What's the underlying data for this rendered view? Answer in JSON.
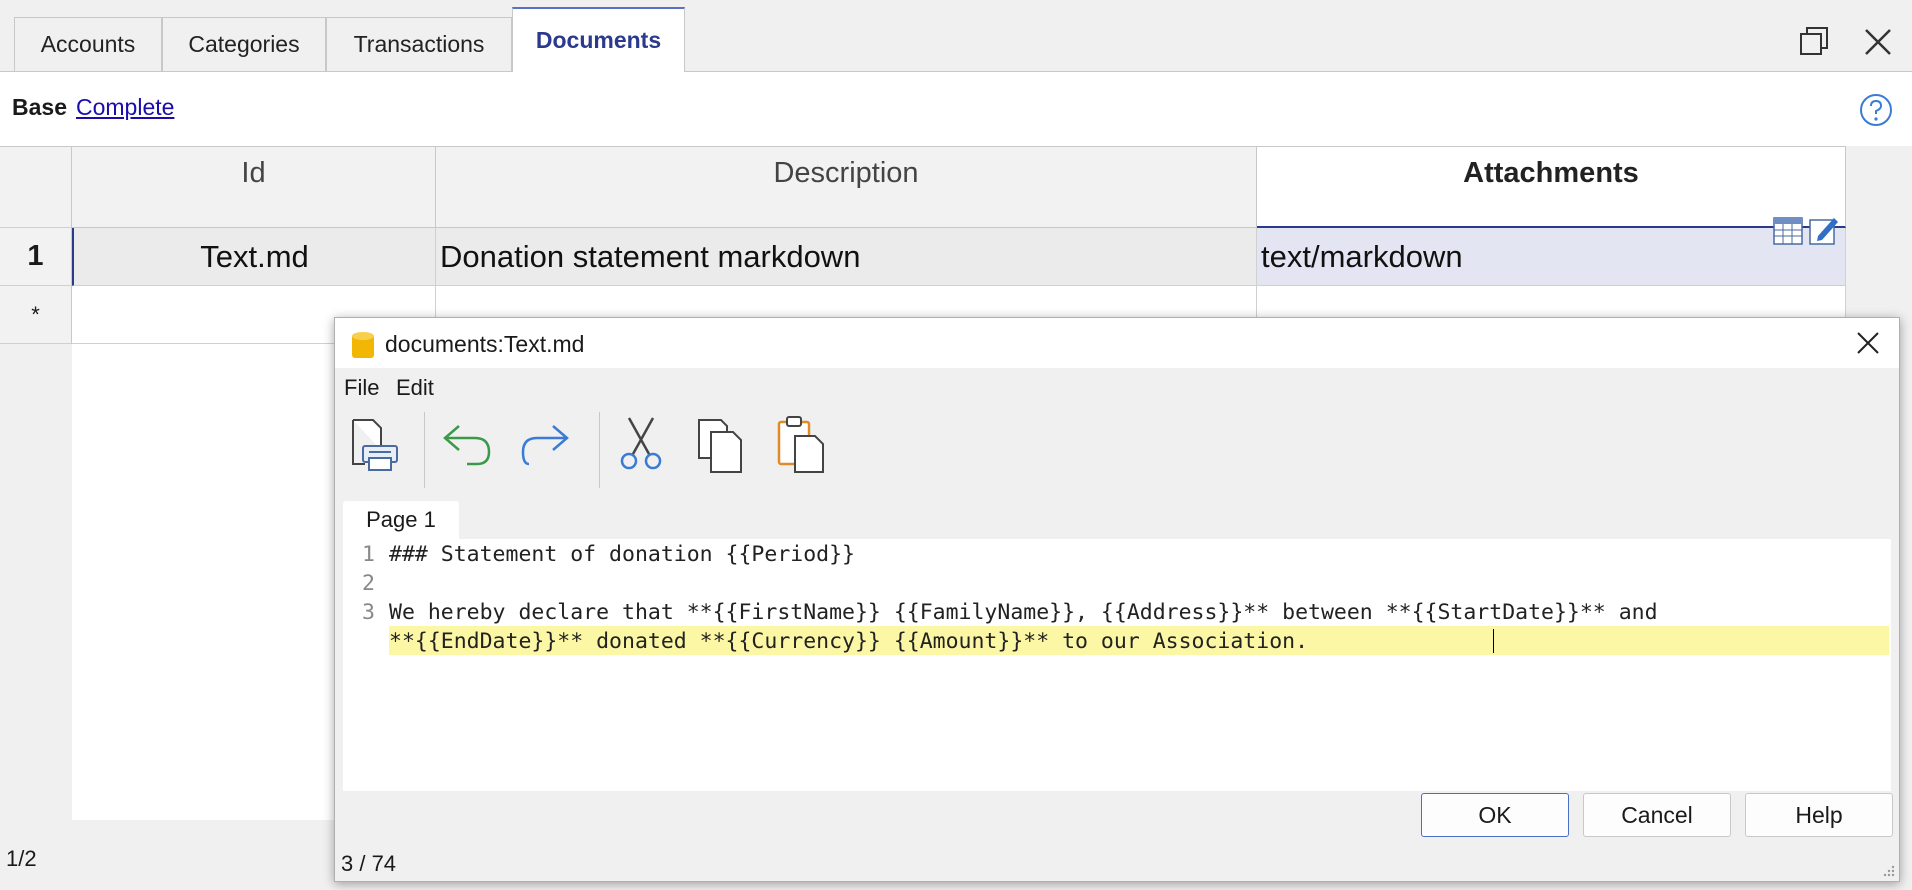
{
  "tabs": [
    {
      "label": "Accounts"
    },
    {
      "label": "Categories"
    },
    {
      "label": "Transactions"
    },
    {
      "label": "Documents",
      "active": true
    }
  ],
  "view": {
    "base_label": "Base",
    "complete_label": "Complete"
  },
  "table": {
    "columns": [
      "Id",
      "Description",
      "Attachments"
    ],
    "rows": [
      {
        "num": "1",
        "id": "Text.md",
        "description": "Donation statement markdown",
        "attachments": "text/markdown"
      }
    ],
    "new_row_marker": "*"
  },
  "status": {
    "records": "1/2"
  },
  "dialog": {
    "title": "documents:Text.md",
    "menu": [
      "File",
      "Edit"
    ],
    "toolbar": [
      "print-icon",
      "undo-icon",
      "redo-icon",
      "cut-icon",
      "copy-icon",
      "paste-icon"
    ],
    "page_tab": "Page 1",
    "lines": [
      {
        "num": "1",
        "text": "### Statement of donation {{Period}}"
      },
      {
        "num": "2",
        "text": ""
      },
      {
        "num": "3",
        "text": "We hereby declare that **{{FirstName}} {{FamilyName}}, {{Address}}** between **{{StartDate}}** and"
      },
      {
        "num": "",
        "text": "**{{EndDate}}** donated **{{Currency}} {{Amount}}** to our Association. "
      }
    ],
    "buttons": {
      "ok": "OK",
      "cancel": "Cancel",
      "help": "Help"
    },
    "status": "3 / 74"
  },
  "colors": {
    "accent": "#2b3a8c",
    "selection": "#e3e6f2",
    "highlight": "#fcf7a4",
    "link": "#1a0dab"
  }
}
